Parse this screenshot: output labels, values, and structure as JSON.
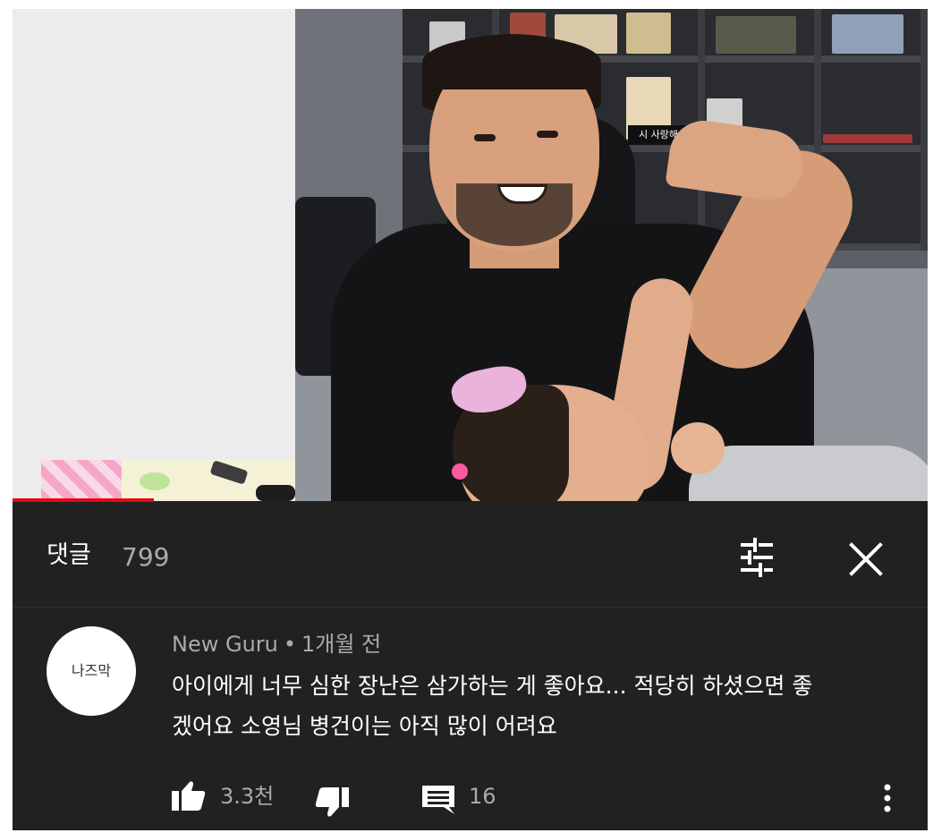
{
  "video": {
    "scene_sign_text": "시 사랑해",
    "progress_fraction": 0.154
  },
  "comments": {
    "title": "댓글",
    "count": "799",
    "sort_icon": "sort-icon",
    "close_icon": "close-icon"
  },
  "comment": {
    "avatar_text": "나즈막",
    "author": "New Guru",
    "separator": "•",
    "time": "1개월 전",
    "text_line_1": "아이에게 너무 심한 장난은 삼가하는 게 좋아요... 적당히 하셨으면 좋",
    "text_line_2": "겠어요 소영님 병건이는 아직 많이 어려요",
    "like_count": "3.3천",
    "reply_count": "16",
    "like_icon": "thumbs-up-icon",
    "dislike_icon": "thumbs-down-icon",
    "reply_icon": "reply-icon",
    "more_icon": "more-vert-icon"
  },
  "colors": {
    "panel_bg": "#212121",
    "text_primary": "#ffffff",
    "text_secondary": "#aaaaaa",
    "progress": "#e50914"
  }
}
